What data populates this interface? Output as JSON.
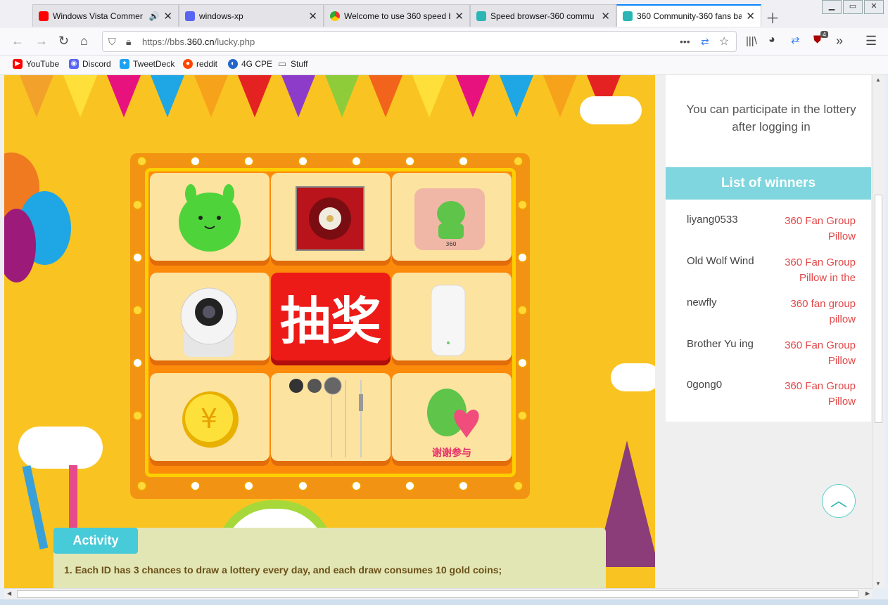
{
  "browser": {
    "tabs": [
      {
        "title": "Windows Vista Commer",
        "favicon": "youtube-icon",
        "color": "#ff0000",
        "audio": "🔊"
      },
      {
        "title": "windows-xp",
        "favicon": "discord-like-icon",
        "color": "#5865f2"
      },
      {
        "title": "Welcome to use 360 speed b",
        "favicon": "chrome-like-icon",
        "color": "#e8a020"
      },
      {
        "title": "Speed browser-360 commu",
        "favicon": "360-community-icon",
        "color": "#2bb5b5"
      },
      {
        "title": "360 Community-360 fans ba",
        "favicon": "360-community-icon",
        "color": "#2bb5b5"
      }
    ],
    "url_host": "https://bbs.",
    "url_domain": "360.cn",
    "url_path": "/lucky.php",
    "extension_badge": "4",
    "bookmarks": [
      {
        "label": "YouTube",
        "color": "#ff0000",
        "glyph": "▶"
      },
      {
        "label": "Discord",
        "color": "#5865f2",
        "glyph": "◉"
      },
      {
        "label": "TweetDeck",
        "color": "#1da1f2",
        "glyph": "✦"
      },
      {
        "label": "reddit",
        "color": "#ff4500",
        "glyph": "●"
      },
      {
        "label": "4G CPE",
        "color": "#2266cc",
        "glyph": "◐"
      },
      {
        "label": "Stuff",
        "color": "#666666",
        "glyph": "▭"
      }
    ]
  },
  "lottery": {
    "center_label": "抽奖",
    "thanks_label": "谢谢参与"
  },
  "activity": {
    "title": "Activity",
    "rule_1": "1. Each ID has 3 chances to draw a lottery every day, and each draw consumes 10 gold coins;"
  },
  "sidebar": {
    "login_message": "You can participate in the lottery after logging in",
    "winners_title": "List of winners",
    "winners": [
      {
        "name": "liyang0533",
        "prize": "360 Fan Group Pillow"
      },
      {
        "name": "Old Wolf Wind",
        "prize": "360 Fan Group Pillow in the"
      },
      {
        "name": "newfly",
        "prize": "360 fan group pillow"
      },
      {
        "name": "Brother Yu ing",
        "prize": "360 Fan Group Pillow"
      },
      {
        "name": "0gong0",
        "prize": "360 Fan Group Pillow"
      }
    ]
  },
  "colors": {
    "stage_bg": "#f9c421",
    "board": "#f39313",
    "center_cell": "#ec1b18",
    "winners_header": "#7fd6df",
    "prize_text": "#e24848",
    "activity_header": "#48cbd8"
  }
}
